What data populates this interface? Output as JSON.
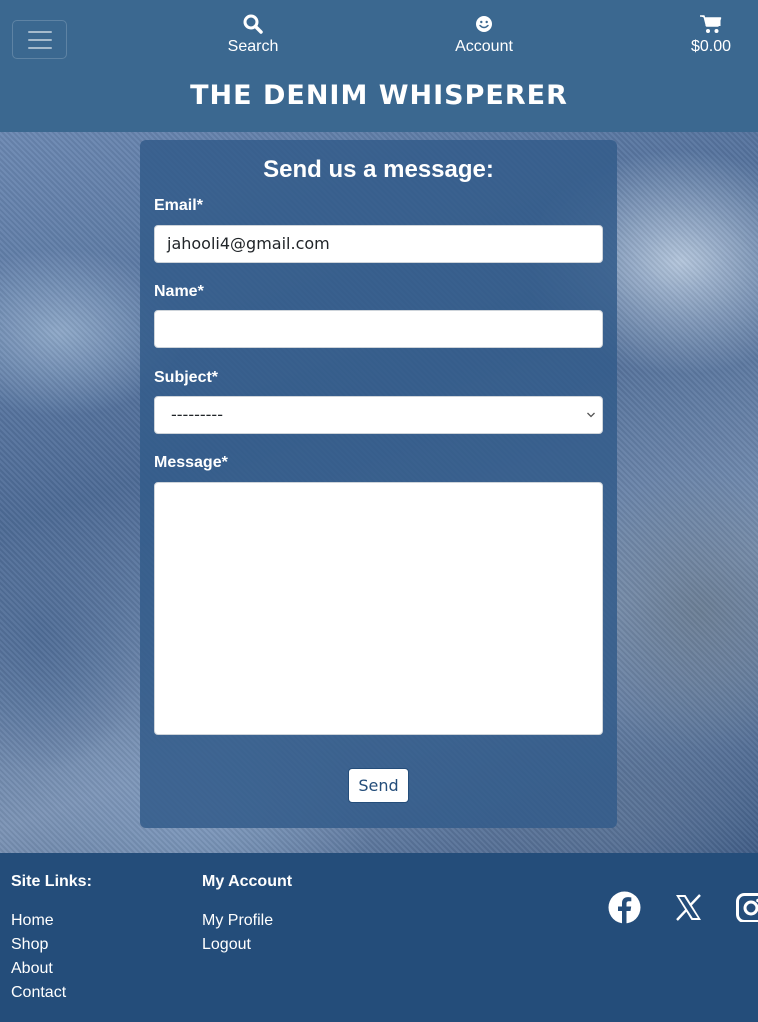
{
  "header": {
    "nav": {
      "search_label": "Search",
      "account_label": "Account",
      "cart_total": "$0.00"
    },
    "logo_text": "THE DENIM WHISPERER"
  },
  "contact_form": {
    "title": "Send us a message:",
    "email_label": "Email*",
    "email_value": "jahooli4@gmail.com",
    "name_label": "Name*",
    "name_value": "",
    "subject_label": "Subject*",
    "subject_selected": "---------",
    "message_label": "Message*",
    "message_value": "",
    "send_label": "Send"
  },
  "footer": {
    "site_links_heading": "Site Links:",
    "site_links": [
      "Home",
      "Shop",
      "About",
      "Contact"
    ],
    "account_heading": "My Account",
    "account_links": [
      "My Profile",
      "Logout"
    ],
    "social_icons": [
      "facebook-icon",
      "x-icon",
      "instagram-icon"
    ]
  },
  "colors": {
    "header_bg": "#3b6890",
    "footer_bg": "#244d7a",
    "panel_bg": "#335c8a",
    "button_text": "#244d7a"
  }
}
